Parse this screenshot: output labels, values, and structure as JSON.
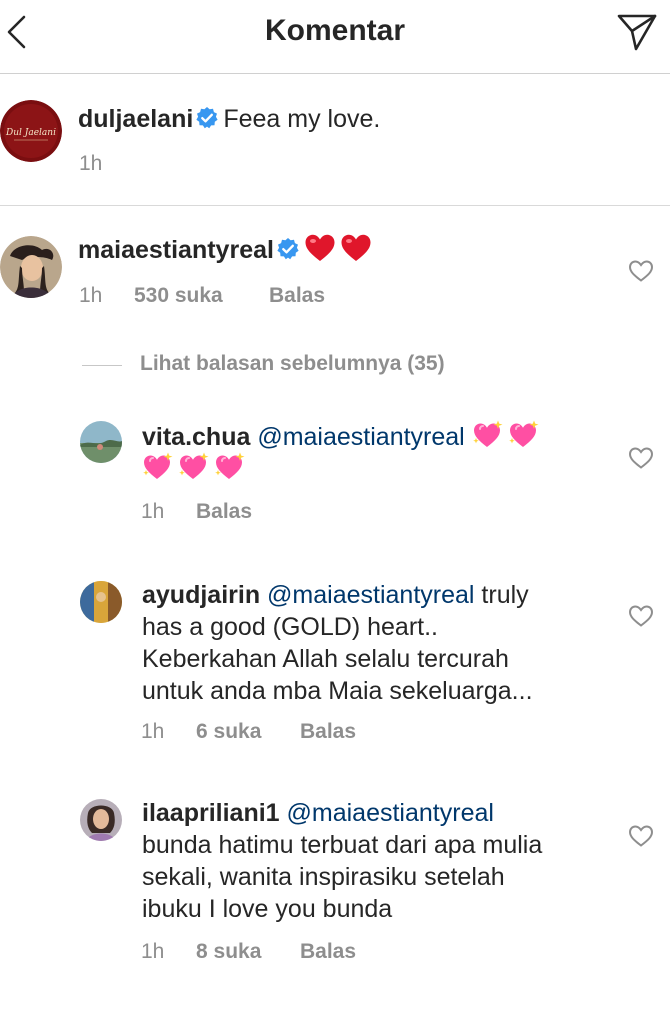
{
  "header": {
    "title": "Komentar"
  },
  "caption": {
    "avatar_text": "Dul Jaelani",
    "username": "duljaelani",
    "text": "Feea my love.",
    "time": "1h"
  },
  "comment_main": {
    "username": "maiaestiantyreal",
    "time": "1h",
    "likes": "530 suka",
    "reply": "Balas"
  },
  "view_previous": "Lihat balasan sebelumnya (35)",
  "replies": [
    {
      "username": "vita.chua",
      "mention": "@maiaestiantyreal",
      "time": "1h",
      "reply": "Balas"
    },
    {
      "username": "ayudjairin",
      "mention": "@maiaestiantyreal",
      "line1_rest": "truly",
      "line2": "has a good (GOLD) heart..",
      "line3": "Keberkahan Allah selalu tercurah",
      "line4": "untuk anda mba Maia sekeluarga...",
      "time": "1h",
      "likes": "6 suka",
      "reply": "Balas"
    },
    {
      "username": "ilaapriliani1",
      "mention": "@maiaestiantyreal",
      "line2": "bunda hatimu terbuat dari apa mulia",
      "line3": "sekali, wanita inspirasiku setelah",
      "line4": "ibuku I love you bunda",
      "time": "1h",
      "likes": "8 suka",
      "reply": "Balas"
    }
  ],
  "colors": {
    "text": "#262626",
    "secondary": "#8e8e8e",
    "mention": "#00376b",
    "verified": "#3897f0",
    "red_heart": "#e0162b",
    "sparkle_heart": "#ff4fa3"
  },
  "icons": {
    "back": "chevron-left",
    "send": "paper-plane",
    "verified": "verified-badge",
    "like": "heart-outline",
    "emoji_red": "red-heart",
    "emoji_sparkle": "sparkling-heart"
  }
}
